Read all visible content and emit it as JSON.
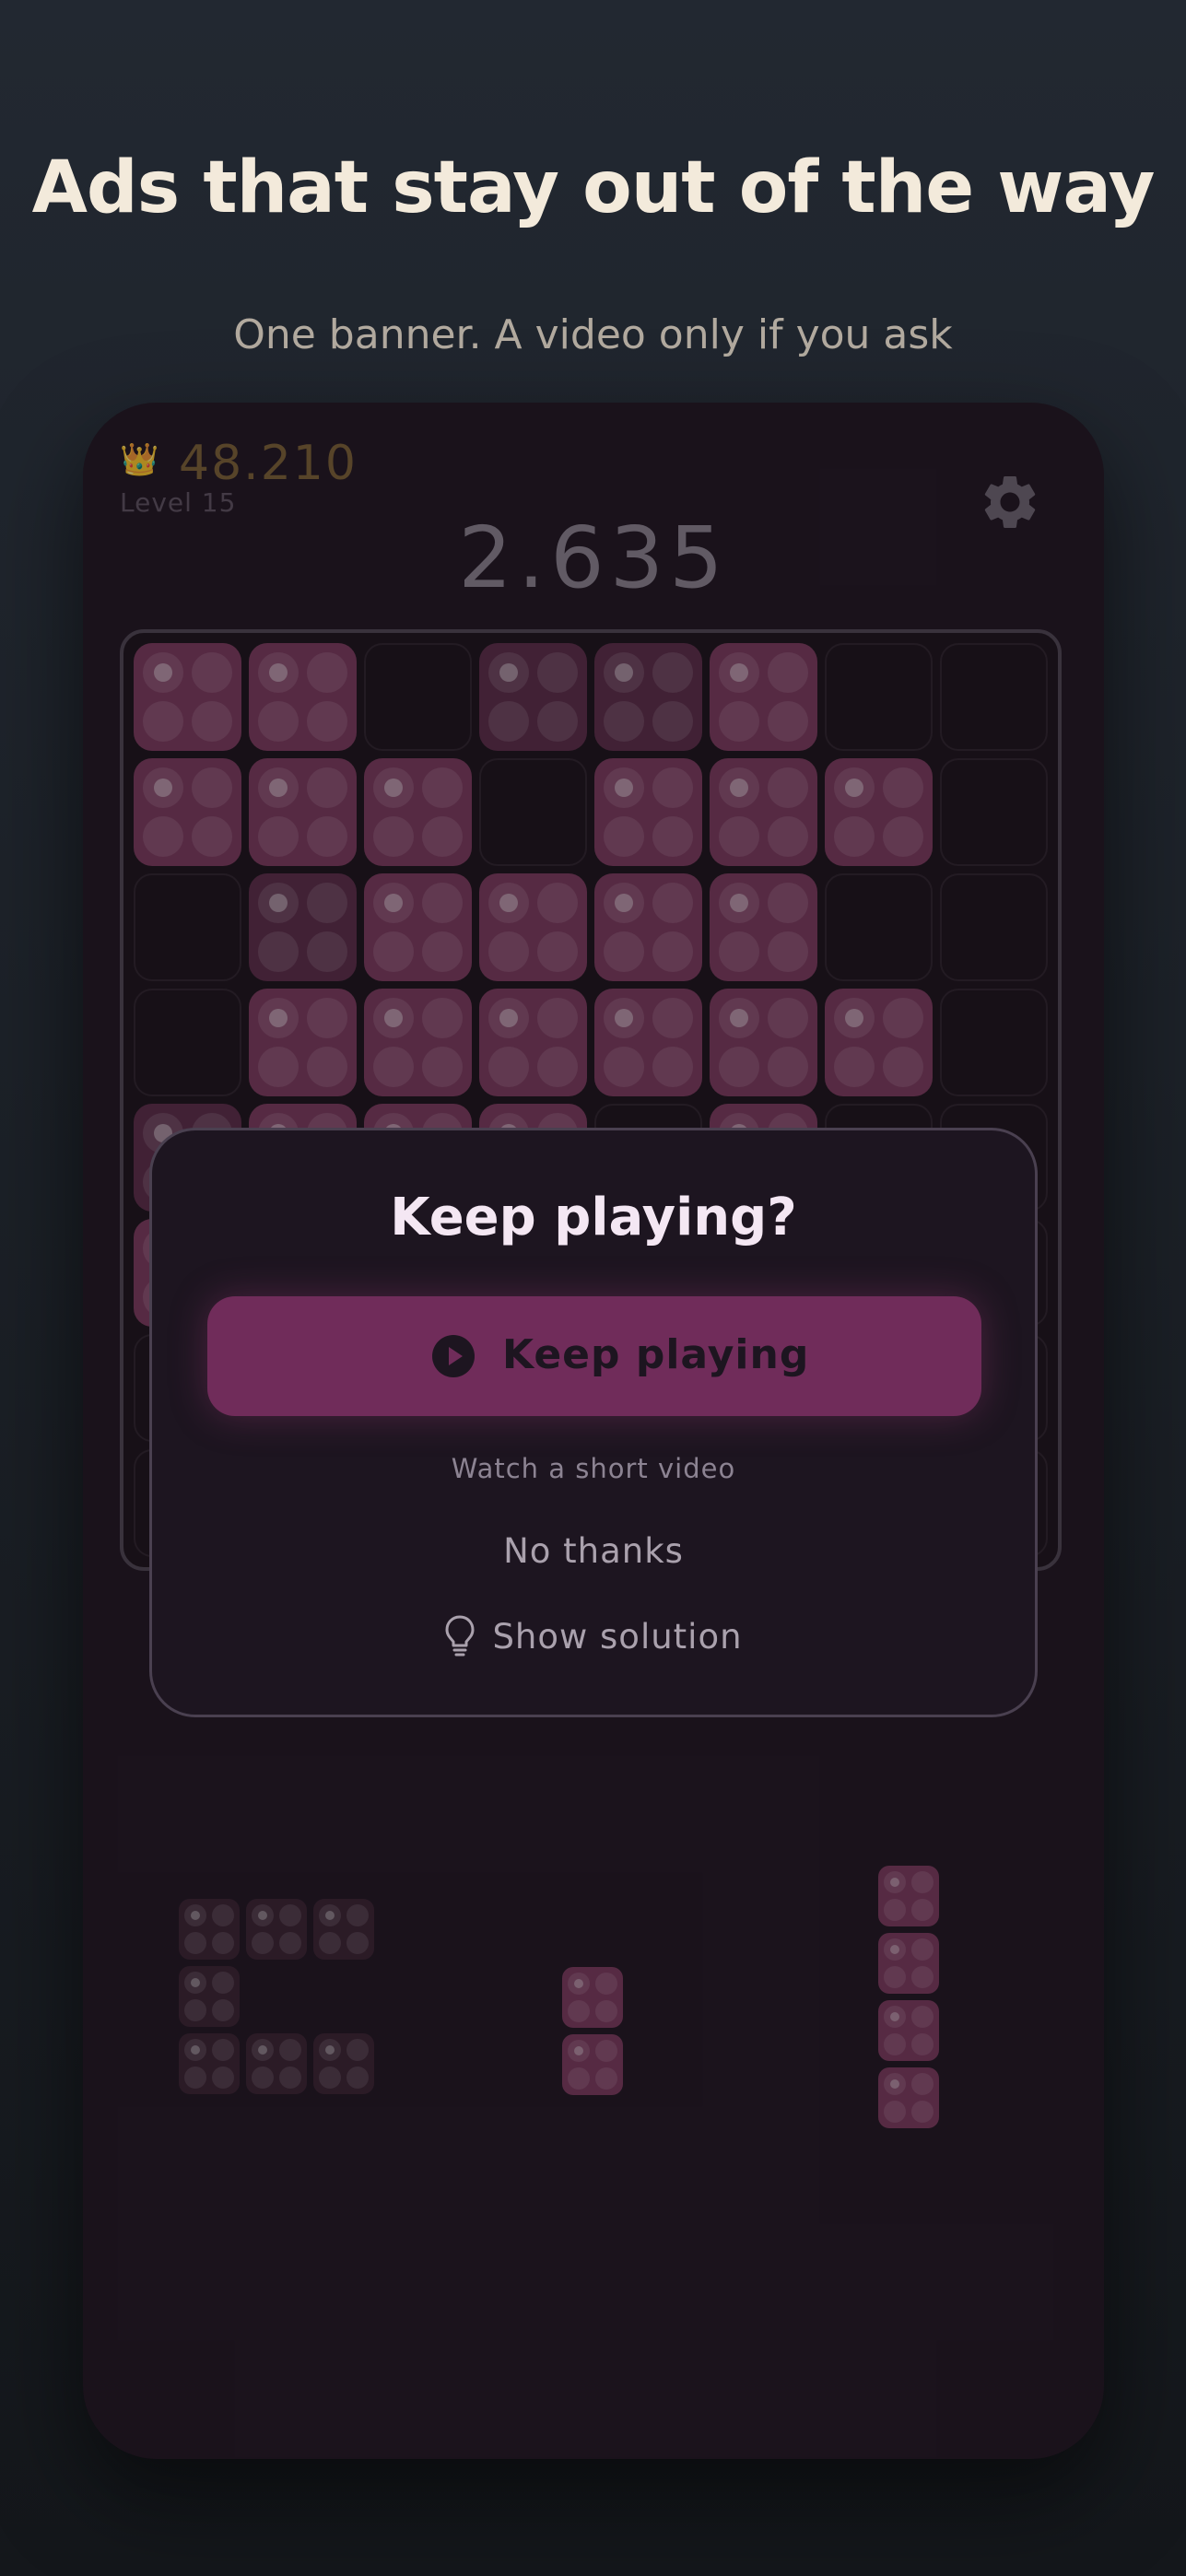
{
  "promo": {
    "headline": "Ads that stay out of the way",
    "subhead": "One banner. A video only if you ask"
  },
  "hud": {
    "crown_icon": "crown-icon",
    "best_score": "48.210",
    "level": "Level 15",
    "score": "2.635",
    "settings_icon": "gear-icon"
  },
  "colors": {
    "accent": "#702c5a",
    "block": "#7a3a5d",
    "background": "#1e1520"
  },
  "board": {
    "size": 8,
    "rows": [
      [
        "filled",
        "filled",
        "empty",
        "dim",
        "dim",
        "filled",
        "empty",
        "empty"
      ],
      [
        "filled",
        "filled",
        "filled",
        "empty",
        "filled",
        "filled",
        "filled",
        "empty"
      ],
      [
        "empty",
        "dim",
        "filled",
        "filled",
        "filled",
        "filled",
        "empty",
        "empty"
      ],
      [
        "empty",
        "filled",
        "filled",
        "filled",
        "filled",
        "filled",
        "filled",
        "empty"
      ],
      [
        "dim",
        "filled",
        "filled",
        "filled",
        "empty",
        "filled",
        "empty",
        "empty"
      ],
      [
        "filled",
        "empty",
        "empty",
        "empty",
        "empty",
        "empty",
        "empty",
        "empty"
      ],
      [
        "empty",
        "empty",
        "empty",
        "empty",
        "empty",
        "empty",
        "empty",
        "empty"
      ],
      [
        "empty",
        "empty",
        "empty",
        "empty",
        "empty",
        "empty",
        "empty",
        "empty"
      ]
    ]
  },
  "dialog": {
    "title": "Keep playing?",
    "primary_label": "Keep playing",
    "primary_icon": "play-icon",
    "hint": "Watch a short video",
    "no_thanks": "No thanks",
    "show_solution": "Show solution",
    "solution_icon": "lightbulb-icon"
  },
  "pieces": [
    {
      "name": "piece-c-shape",
      "available": false,
      "cells": [
        [
          0,
          0
        ],
        [
          1,
          0
        ],
        [
          2,
          0
        ],
        [
          0,
          1
        ],
        [
          0,
          2
        ],
        [
          1,
          2
        ],
        [
          2,
          2
        ]
      ]
    },
    {
      "name": "piece-vertical-2",
      "available": true,
      "cells": [
        [
          0,
          0
        ],
        [
          0,
          1
        ]
      ]
    },
    {
      "name": "piece-vertical-4",
      "available": true,
      "cells": [
        [
          0,
          0
        ],
        [
          0,
          1
        ],
        [
          0,
          2
        ],
        [
          0,
          3
        ]
      ]
    }
  ]
}
